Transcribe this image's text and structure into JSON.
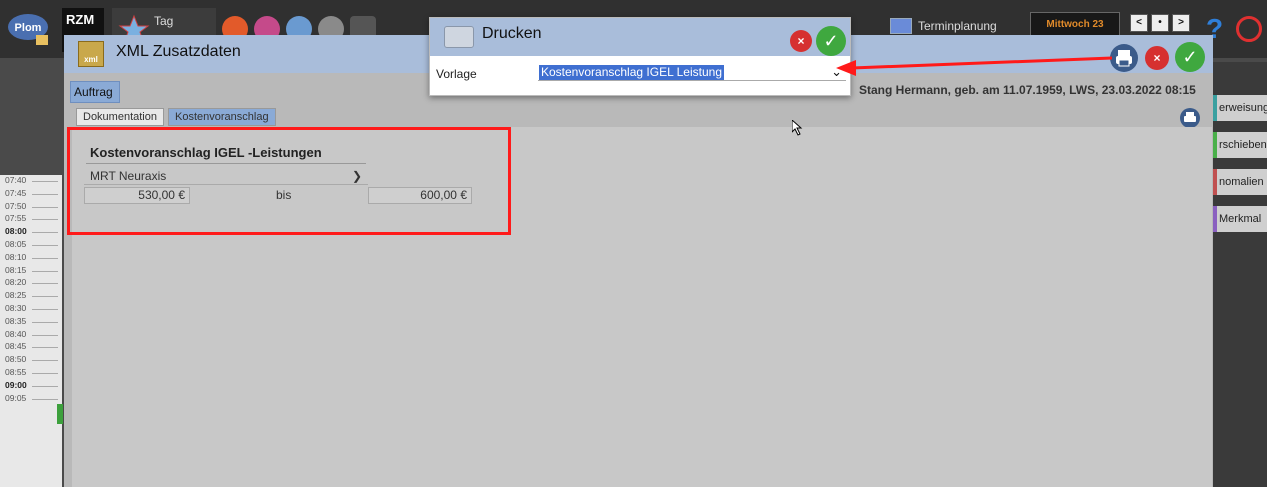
{
  "topbar": {
    "rzm_label": "RZM",
    "tag_label": "Tag",
    "termin_label": "Terminplanung",
    "date_label": "Mittwoch 23",
    "help_symbol": "?",
    "nav": [
      "<",
      "•",
      ">"
    ]
  },
  "xml_window": {
    "title": "XML Zusatzdaten",
    "auftrag_label": "Auftrag",
    "patient_info": "Stang Hermann, geb. am 11.07.1959, LWS, 23.03.2022 08:15",
    "tabs": [
      "Dokumentation",
      "Kostenvoranschlag"
    ],
    "icon_text": "xml"
  },
  "kostenvoranschlag": {
    "title": "Kostenvoranschlag IGEL -Leistungen",
    "selected": "MRT Neuraxis",
    "price_from": "530,00 €",
    "bis_label": "bis",
    "price_to": "600,00 €"
  },
  "drucken_dialog": {
    "title": "Drucken",
    "vorlage_label": "Vorlage",
    "vorlage_value": "Kostenvoranschlag IGEL Leistung"
  },
  "side_buttons": [
    "erweisung",
    "rschieben",
    "nomalien",
    "Merkmal"
  ],
  "times": [
    "07:40",
    "07:45",
    "07:50",
    "07:55",
    "08:00",
    "08:05",
    "08:10",
    "08:15",
    "08:20",
    "08:25",
    "08:30",
    "08:35",
    "08:40",
    "08:45",
    "08:50",
    "08:55",
    "09:00",
    "09:05"
  ],
  "colors": {
    "accent_blue": "#a9bdda",
    "highlight_red": "#ff1a1a",
    "ok_green": "#3fa83f",
    "close_red": "#d63030"
  }
}
